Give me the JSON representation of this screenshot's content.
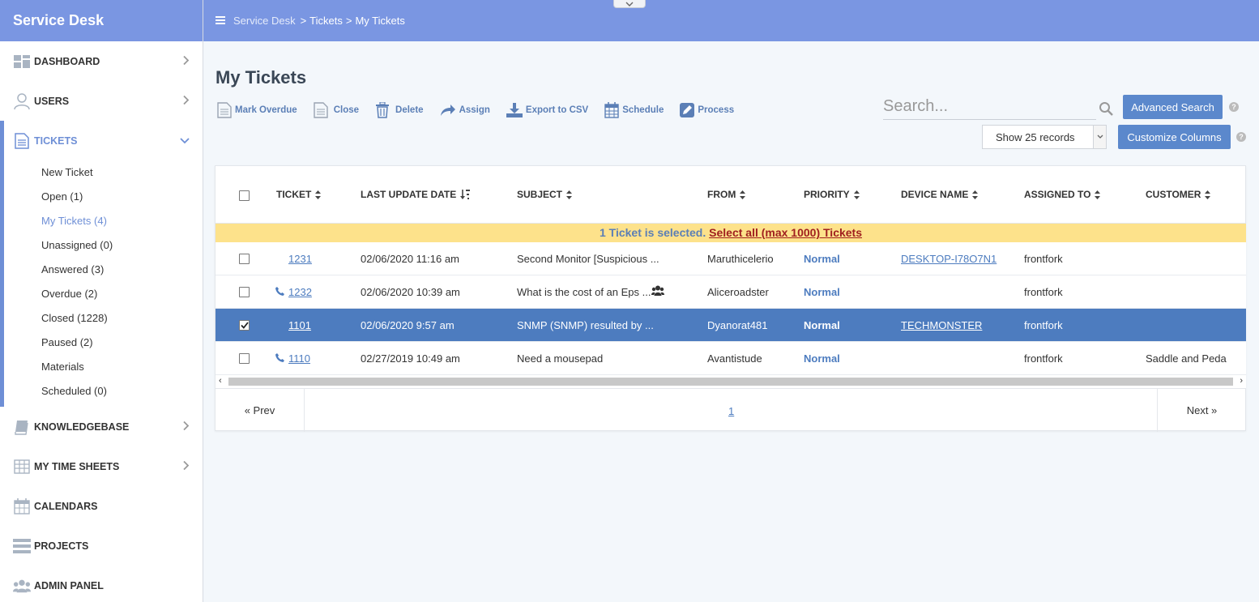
{
  "app": {
    "brand": "Service Desk"
  },
  "breadcrumb": {
    "root": "Service Desk",
    "section": "Tickets",
    "current": "My Tickets",
    "sep": ">"
  },
  "sidebar": {
    "dashboard": "DASHBOARD",
    "users": "USERS",
    "tickets": "TICKETS",
    "ticket_items": [
      {
        "label": "New Ticket"
      },
      {
        "label": "Open (1)"
      },
      {
        "label": "My Tickets (4)"
      },
      {
        "label": "Unassigned (0)"
      },
      {
        "label": "Answered (3)"
      },
      {
        "label": "Overdue (2)"
      },
      {
        "label": "Closed (1228)"
      },
      {
        "label": "Paused (2)"
      },
      {
        "label": "Materials"
      },
      {
        "label": "Scheduled (0)"
      }
    ],
    "knowledgebase": "KNOWLEDGEBASE",
    "timesheets": "MY TIME SHEETS",
    "calendars": "CALENDARS",
    "projects": "PROJECTS",
    "admin": "ADMIN PANEL"
  },
  "page": {
    "title": "My Tickets"
  },
  "toolbar": {
    "mark_overdue": "Mark Overdue",
    "close": "Close",
    "delete": "Delete",
    "assign": "Assign",
    "export": "Export to CSV",
    "schedule": "Schedule",
    "process": "Process"
  },
  "search": {
    "placeholder": "Search...",
    "advanced": "Advanced Search"
  },
  "records": {
    "selected": "Show 25 records"
  },
  "customize": "Customize Columns",
  "help_glyph": "?",
  "table": {
    "headers": {
      "ticket": "TICKET",
      "last_update": "LAST UPDATE DATE",
      "subject": "SUBJECT",
      "from": "FROM",
      "priority": "PRIORITY",
      "device": "DEVICE NAME",
      "assigned": "ASSIGNED TO",
      "customer": "CUSTOMER"
    },
    "banner": {
      "text": "1 Ticket is selected. ",
      "link": "Select all (max 1000) Tickets"
    },
    "rows": [
      {
        "ticket": "1231",
        "date": "02/06/2020 11:16 am",
        "subject": "Second Monitor [Suspicious ...",
        "from": "Maruthicelerio",
        "priority": "Normal",
        "device": "DESKTOP-I78O7N1",
        "assigned": "frontfork",
        "customer": ""
      },
      {
        "ticket": "1232",
        "date": "02/06/2020 10:39 am",
        "subject": "What is the cost of an Eps ...",
        "from": "Aliceroadster",
        "priority": "Normal",
        "device": "",
        "assigned": "frontfork",
        "customer": ""
      },
      {
        "ticket": "1101",
        "date": "02/06/2020 9:57 am",
        "subject": "SNMP (SNMP) resulted by ...",
        "from": "Dyanorat481",
        "priority": "Normal",
        "device": "TECHMONSTER",
        "assigned": "frontfork",
        "customer": ""
      },
      {
        "ticket": "1110",
        "date": "02/27/2019 10:49 am",
        "subject": "Need a mousepad",
        "from": "Avantistude",
        "priority": "Normal",
        "device": "",
        "assigned": "frontfork",
        "customer": "Saddle and Peda"
      }
    ]
  },
  "pager": {
    "prev": "« Prev",
    "page": "1",
    "next": "Next »"
  }
}
